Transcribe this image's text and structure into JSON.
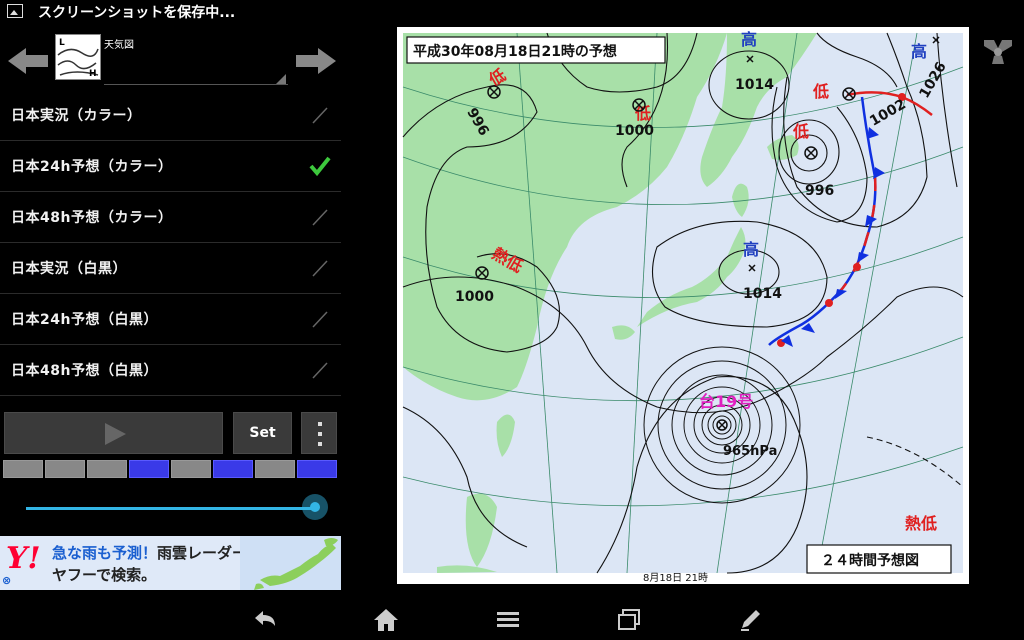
{
  "status": {
    "text": "スクリーンショットを保存中..."
  },
  "header": {
    "map_name": "天気図",
    "thumb_letters": [
      "L",
      "H"
    ]
  },
  "list": {
    "items": [
      {
        "label": "日本実況（カラー）",
        "checked": false
      },
      {
        "label": "日本24h予想（カラー）",
        "checked": true
      },
      {
        "label": "日本48h予想（カラー）",
        "checked": false
      },
      {
        "label": "日本実況（白黒）",
        "checked": false
      },
      {
        "label": "日本24h予想（白黒）",
        "checked": false
      },
      {
        "label": "日本48h予想（白黒）",
        "checked": false
      }
    ]
  },
  "controls": {
    "set_label": "Set"
  },
  "frames": {
    "active": [
      false,
      false,
      false,
      true,
      false,
      true,
      false,
      true
    ]
  },
  "slider": {
    "value": 1.0
  },
  "ad": {
    "logo": "Y!",
    "line1_highlight": "急な雨も予測！",
    "line1_rest": "雨雲レーダーを",
    "line2": "ヤフーで検索。",
    "close": "⊗"
  },
  "map": {
    "title": "平成30年08月18日21時の予想",
    "footer_label": "２４時間予想図",
    "bottom_date": "8月18日 21時",
    "typhoon_label": "台19号",
    "typhoon_pressure": "965hPa",
    "systems": [
      {
        "kind": "低",
        "pressure": "996"
      },
      {
        "kind": "低",
        "pressure": "1000"
      },
      {
        "kind": "高",
        "pressure": "1014"
      },
      {
        "kind": "低",
        "pressure": "996"
      },
      {
        "kind": "低",
        "pressure": "1002"
      },
      {
        "kind": "高",
        "pressure": "1026"
      },
      {
        "kind": "熱低",
        "pressure": "1000"
      },
      {
        "kind": "高",
        "pressure": "1014"
      },
      {
        "kind": "熱低",
        "pressure": ""
      }
    ],
    "colors": {
      "sea": "#dce6f5",
      "land": "#a8e0a8",
      "low": "#e02020",
      "high": "#2040c0",
      "typhoon": "#e020c0"
    }
  }
}
